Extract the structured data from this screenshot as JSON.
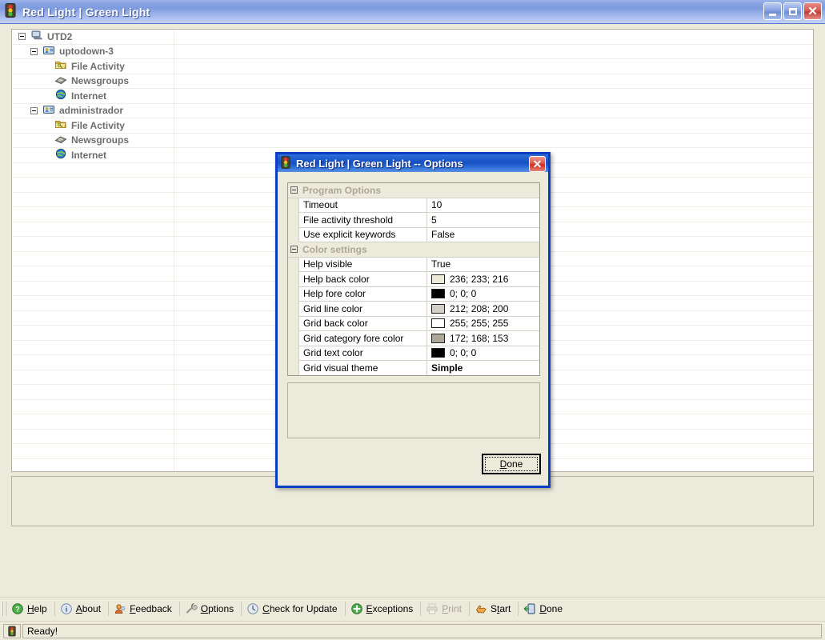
{
  "main_window": {
    "title": "Red Light | Green Light",
    "icon": "traffic-light-icon",
    "window_buttons": {
      "minimize": "_",
      "maximize": "□",
      "close": "✕"
    }
  },
  "tree": {
    "nodes": [
      {
        "label": "UTD2",
        "level": 0,
        "icon": "computer-icon",
        "expander": "minus"
      },
      {
        "label": "uptodown-3",
        "level": 1,
        "icon": "user-card-icon",
        "expander": "minus"
      },
      {
        "label": "File Activity",
        "level": 2,
        "icon": "folder-key-icon",
        "expander": "none"
      },
      {
        "label": "Newsgroups",
        "level": 2,
        "icon": "newsgroups-icon",
        "expander": "none"
      },
      {
        "label": "Internet",
        "level": 2,
        "icon": "globe-icon",
        "expander": "none"
      },
      {
        "label": "administrador",
        "level": 1,
        "icon": "user-card-icon",
        "expander": "minus"
      },
      {
        "label": "File Activity",
        "level": 2,
        "icon": "folder-key-icon",
        "expander": "none"
      },
      {
        "label": "Newsgroups",
        "level": 2,
        "icon": "newsgroups-icon",
        "expander": "none"
      },
      {
        "label": "Internet",
        "level": 2,
        "icon": "globe-icon",
        "expander": "none"
      }
    ],
    "empty_row_count": 21
  },
  "dialog": {
    "title": "Red Light | Green Light -- Options",
    "icon": "traffic-light-icon",
    "close_label": "✕",
    "done_button": {
      "text_before": "",
      "accelerator": "D",
      "text_after": "one"
    },
    "description_pane_text": "",
    "property_grid": {
      "categories": [
        {
          "name": "Program Options",
          "rows": [
            {
              "name": "Timeout",
              "value": "10",
              "type": "text"
            },
            {
              "name": "File activity threshold",
              "value": "5",
              "type": "text"
            },
            {
              "name": "Use explicit keywords",
              "value": "False",
              "type": "text"
            }
          ]
        },
        {
          "name": "Color settings",
          "rows": [
            {
              "name": "Help visible",
              "value": "True",
              "type": "text"
            },
            {
              "name": "Help back color",
              "value": "236; 233; 216",
              "type": "color",
              "swatch": "#ece9d8"
            },
            {
              "name": "Help fore color",
              "value": "0; 0; 0",
              "type": "color",
              "swatch": "#000000"
            },
            {
              "name": "Grid line color",
              "value": "212; 208; 200",
              "type": "color",
              "swatch": "#d4d0c8"
            },
            {
              "name": "Grid back color",
              "value": "255; 255; 255",
              "type": "color",
              "swatch": "#ffffff"
            },
            {
              "name": "Grid category fore color",
              "value": "172; 168; 153",
              "type": "color",
              "swatch": "#aca899"
            },
            {
              "name": "Grid text color",
              "value": "0; 0; 0",
              "type": "color",
              "swatch": "#000000"
            },
            {
              "name": "Grid visual theme",
              "value": "Simple",
              "type": "bold"
            }
          ]
        }
      ]
    }
  },
  "toolbar": {
    "buttons": [
      {
        "icon": "help-question-icon",
        "text_before": "",
        "accelerator": "H",
        "text_after": "elp",
        "disabled": false
      },
      {
        "icon": "about-info-icon",
        "text_before": "",
        "accelerator": "A",
        "text_after": "bout",
        "disabled": false
      },
      {
        "icon": "feedback-person-icon",
        "text_before": "",
        "accelerator": "F",
        "text_after": "eedback",
        "disabled": false
      },
      {
        "icon": "options-wrench-icon",
        "text_before": "",
        "accelerator": "O",
        "text_after": "ptions",
        "disabled": false
      },
      {
        "icon": "check-update-clock-icon",
        "text_before": "",
        "accelerator": "C",
        "text_after": "heck for Update",
        "disabled": false
      },
      {
        "icon": "exceptions-plus-icon",
        "text_before": "",
        "accelerator": "E",
        "text_after": "xceptions",
        "disabled": false
      },
      {
        "icon": "print-icon",
        "text_before": "",
        "accelerator": "P",
        "text_after": "rint",
        "disabled": true
      },
      {
        "icon": "start-hand-icon",
        "text_before": "S",
        "accelerator": "t",
        "text_after": "art",
        "disabled": false
      },
      {
        "icon": "done-exit-icon",
        "text_before": "",
        "accelerator": "D",
        "text_after": "one",
        "disabled": false
      }
    ]
  },
  "statusbar": {
    "icon": "traffic-light-icon",
    "text": "Ready!"
  },
  "colors": {
    "window_face": "#eceadb",
    "grid_white": "#ffffff",
    "title_blue": "#1750c4",
    "category_fore": "#aca899",
    "tree_text": "#6d6d6d"
  }
}
